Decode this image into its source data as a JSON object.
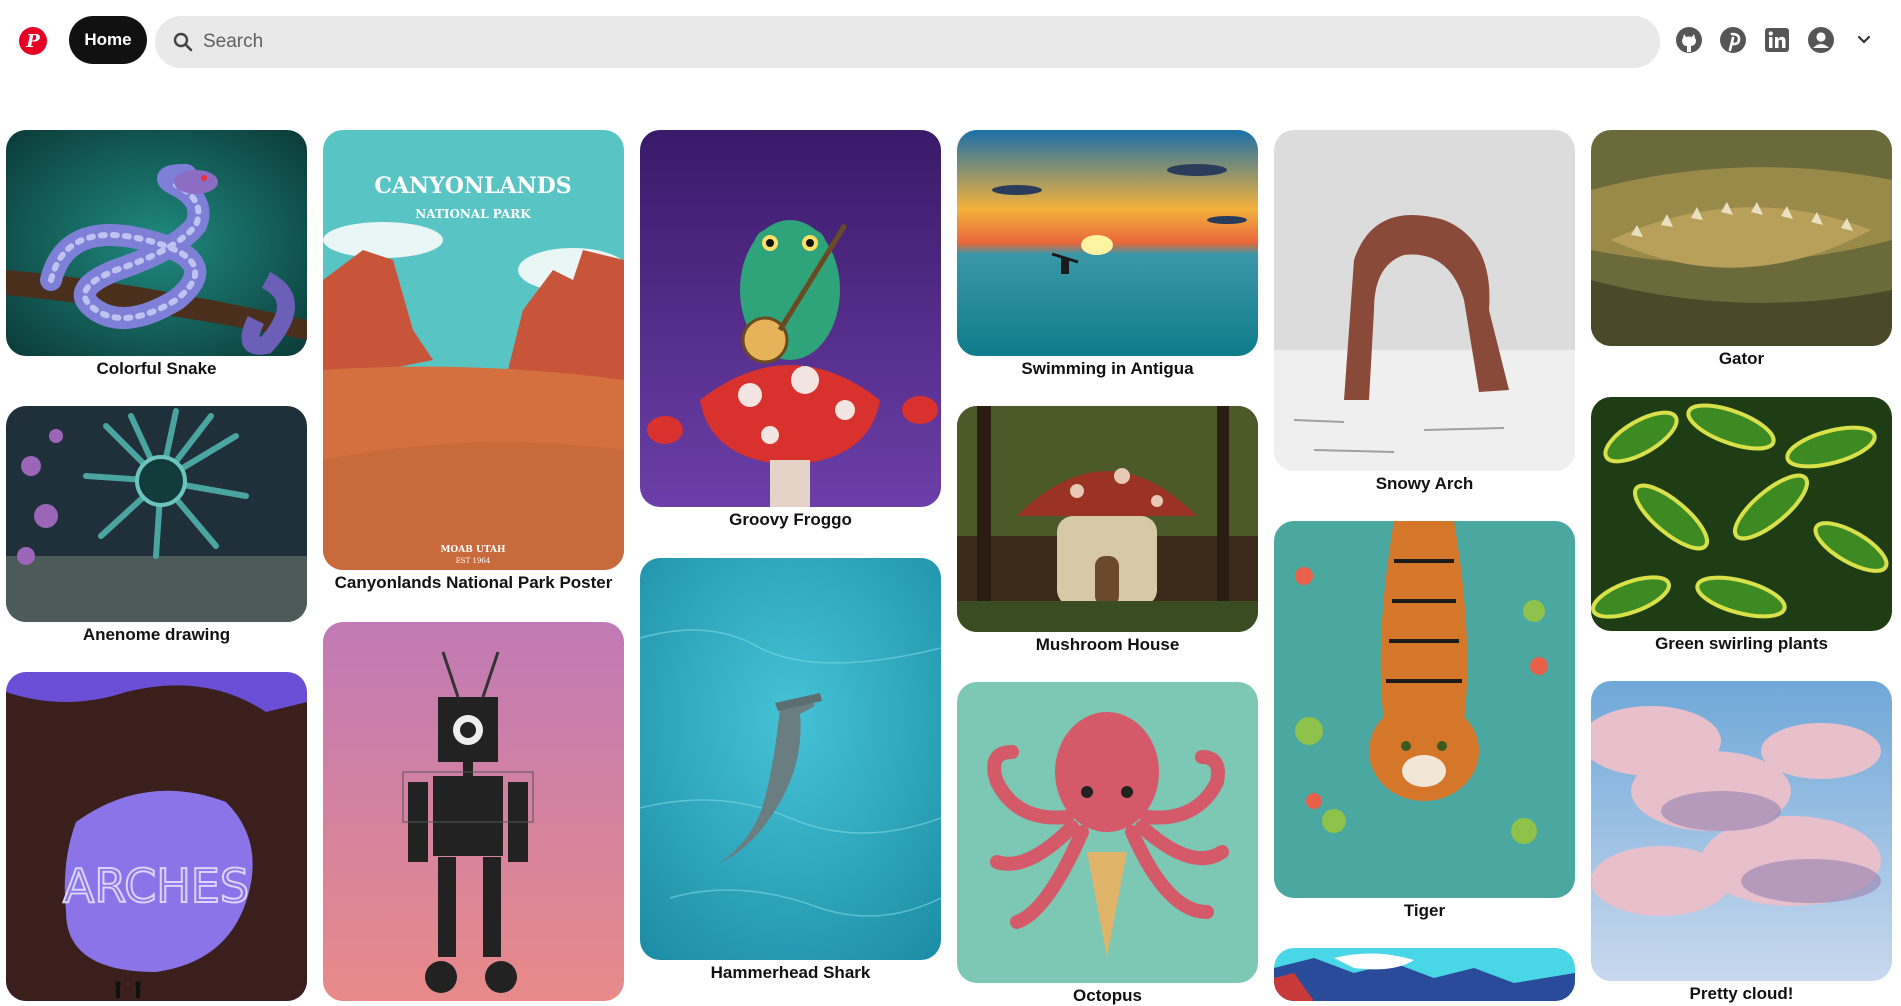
{
  "header": {
    "logo_letter": "P",
    "home_label": "Home",
    "search_placeholder": "Search",
    "icons": [
      "github-icon",
      "pinterest-icon",
      "linkedin-icon",
      "account-icon",
      "chevron-down-icon"
    ]
  },
  "pins": [
    {
      "title": "Colorful Snake"
    },
    {
      "title": "Anenome drawing"
    },
    {
      "title": "Canyonlands National Park Poster"
    },
    {
      "title": "Groovy Froggo"
    },
    {
      "title": "Hammerhead Shark"
    },
    {
      "title": "Swimming in Antigua"
    },
    {
      "title": "Mushroom House"
    },
    {
      "title": "Octopus"
    },
    {
      "title": "Snowy Arch"
    },
    {
      "title": "Tiger"
    },
    {
      "title": "Gator"
    },
    {
      "title": "Green swirling plants"
    },
    {
      "title": "Pretty cloud!"
    }
  ],
  "poster_text": {
    "canyonlands_line1": "CANYONLANDS",
    "canyonlands_line2": "NATIONAL PARK",
    "canyonlands_line3": "MOAB UTAH",
    "canyonlands_line4": "EST 1964",
    "arches": "ARCHES"
  },
  "colors": {
    "brand": "#e60023",
    "home_bg": "#111111",
    "search_bg": "#e9e9e9"
  }
}
